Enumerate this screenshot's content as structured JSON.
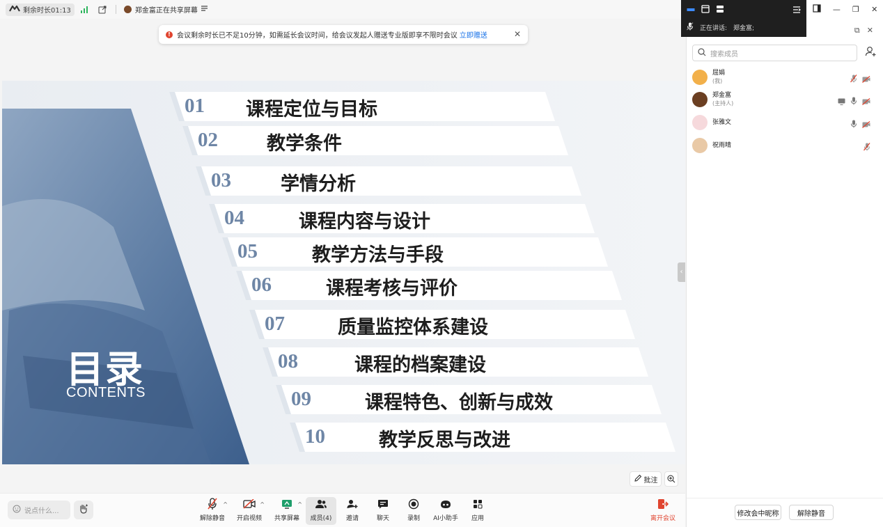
{
  "topbar": {
    "timer": "剩余时长01:13",
    "sharer": "郑金富正在共享屏幕"
  },
  "notice": {
    "message": "会议剩余时长已不足10分钟，如需延长会议时间，给会议发起人赠送专业版即享不限时会议",
    "link": "立即赠送"
  },
  "slide": {
    "title_cn": "目录",
    "title_en": "CONTENTS",
    "items": [
      {
        "num": "01",
        "text": "课程定位与目标"
      },
      {
        "num": "02",
        "text": "教学条件"
      },
      {
        "num": "03",
        "text": "学情分析"
      },
      {
        "num": "04",
        "text": "课程内容与设计"
      },
      {
        "num": "05",
        "text": "教学方法与手段"
      },
      {
        "num": "06",
        "text": "课程考核与评价"
      },
      {
        "num": "07",
        "text": "质量监控体系建设"
      },
      {
        "num": "08",
        "text": "课程的档案建设"
      },
      {
        "num": "09",
        "text": "课程特色、创新与成效"
      },
      {
        "num": "10",
        "text": "教学反思与改进"
      }
    ]
  },
  "stage_controls": {
    "annotate": "批注"
  },
  "toolbar": {
    "say_placeholder": "说点什么...",
    "unmute": "解除静音",
    "start_video": "开启视频",
    "share_screen": "共享屏幕",
    "members": "成员(4)",
    "invite": "邀请",
    "chat": "聊天",
    "record": "录制",
    "ai_assistant": "AI小助手",
    "apps": "应用",
    "leave": "离开会议"
  },
  "panel": {
    "speaking_label": "正在讲话:",
    "speaking_name": "郑金富;",
    "search_placeholder": "搜索成员",
    "members": [
      {
        "name": "屈娟",
        "role": "(我)",
        "avatar_color": "#f2b04a"
      },
      {
        "name": "郑金富",
        "role": "(主持人)",
        "avatar_color": "#6b3f22"
      },
      {
        "name": "张雅文",
        "role": "",
        "avatar_color": "#f6d9dc"
      },
      {
        "name": "祝雨晴",
        "role": "",
        "avatar_color": "#e9c9a6"
      }
    ],
    "rename_btn": "修改会中昵称",
    "unmute_all_btn": "解除静音"
  },
  "colors": {
    "accent_red": "#e0442f",
    "link_blue": "#1a73e8",
    "slide_blue": "#6e86a6"
  }
}
